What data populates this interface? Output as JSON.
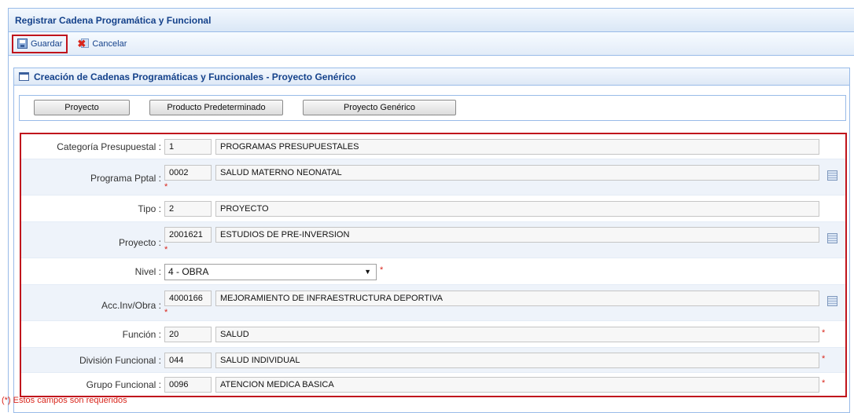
{
  "window": {
    "title": "Registrar Cadena Programática y Funcional"
  },
  "toolbar": {
    "save_label": "Guardar",
    "cancel_label": "Cancelar"
  },
  "panel": {
    "title": "Creación de Cadenas Programáticas y Funcionales - Proyecto Genérico"
  },
  "tabs": [
    "Proyecto",
    "Producto Predeterminado",
    "Proyecto Genérico"
  ],
  "form": {
    "categoria": {
      "label": "Categoría Presupuestal :",
      "code": "1",
      "desc": "PROGRAMAS PRESUPUESTALES"
    },
    "programa": {
      "label": "Programa Pptal :",
      "code": "0002",
      "desc": "SALUD MATERNO NEONATAL"
    },
    "tipo": {
      "label": "Tipo :",
      "code": "2",
      "desc": "PROYECTO"
    },
    "proyecto": {
      "label": "Proyecto :",
      "code": "2001621",
      "desc": "ESTUDIOS DE PRE-INVERSION"
    },
    "nivel": {
      "label": "Nivel :",
      "selected": "4 - OBRA"
    },
    "accion": {
      "label": "Acc.Inv/Obra :",
      "code": "4000166",
      "desc": "MEJORAMIENTO DE INFRAESTRUCTURA DEPORTIVA"
    },
    "funcion": {
      "label": "Función :",
      "code": "20",
      "desc": "SALUD"
    },
    "division": {
      "label": "División Funcional :",
      "code": "044",
      "desc": "SALUD INDIVIDUAL"
    },
    "grupo": {
      "label": "Grupo Funcional :",
      "code": "0096",
      "desc": "ATENCION MEDICA BASICA"
    }
  },
  "required_mark": "*",
  "footnote": "(*) Estos campos son requeridos",
  "icons": {
    "save": "save-icon",
    "cancel": "cancel-icon",
    "lookup": "table-lookup-icon",
    "dropdown": "dropdown-arrow-icon"
  },
  "colors": {
    "highlight": "#c0141c",
    "header_text": "#15428b",
    "required": "#d9261c"
  }
}
